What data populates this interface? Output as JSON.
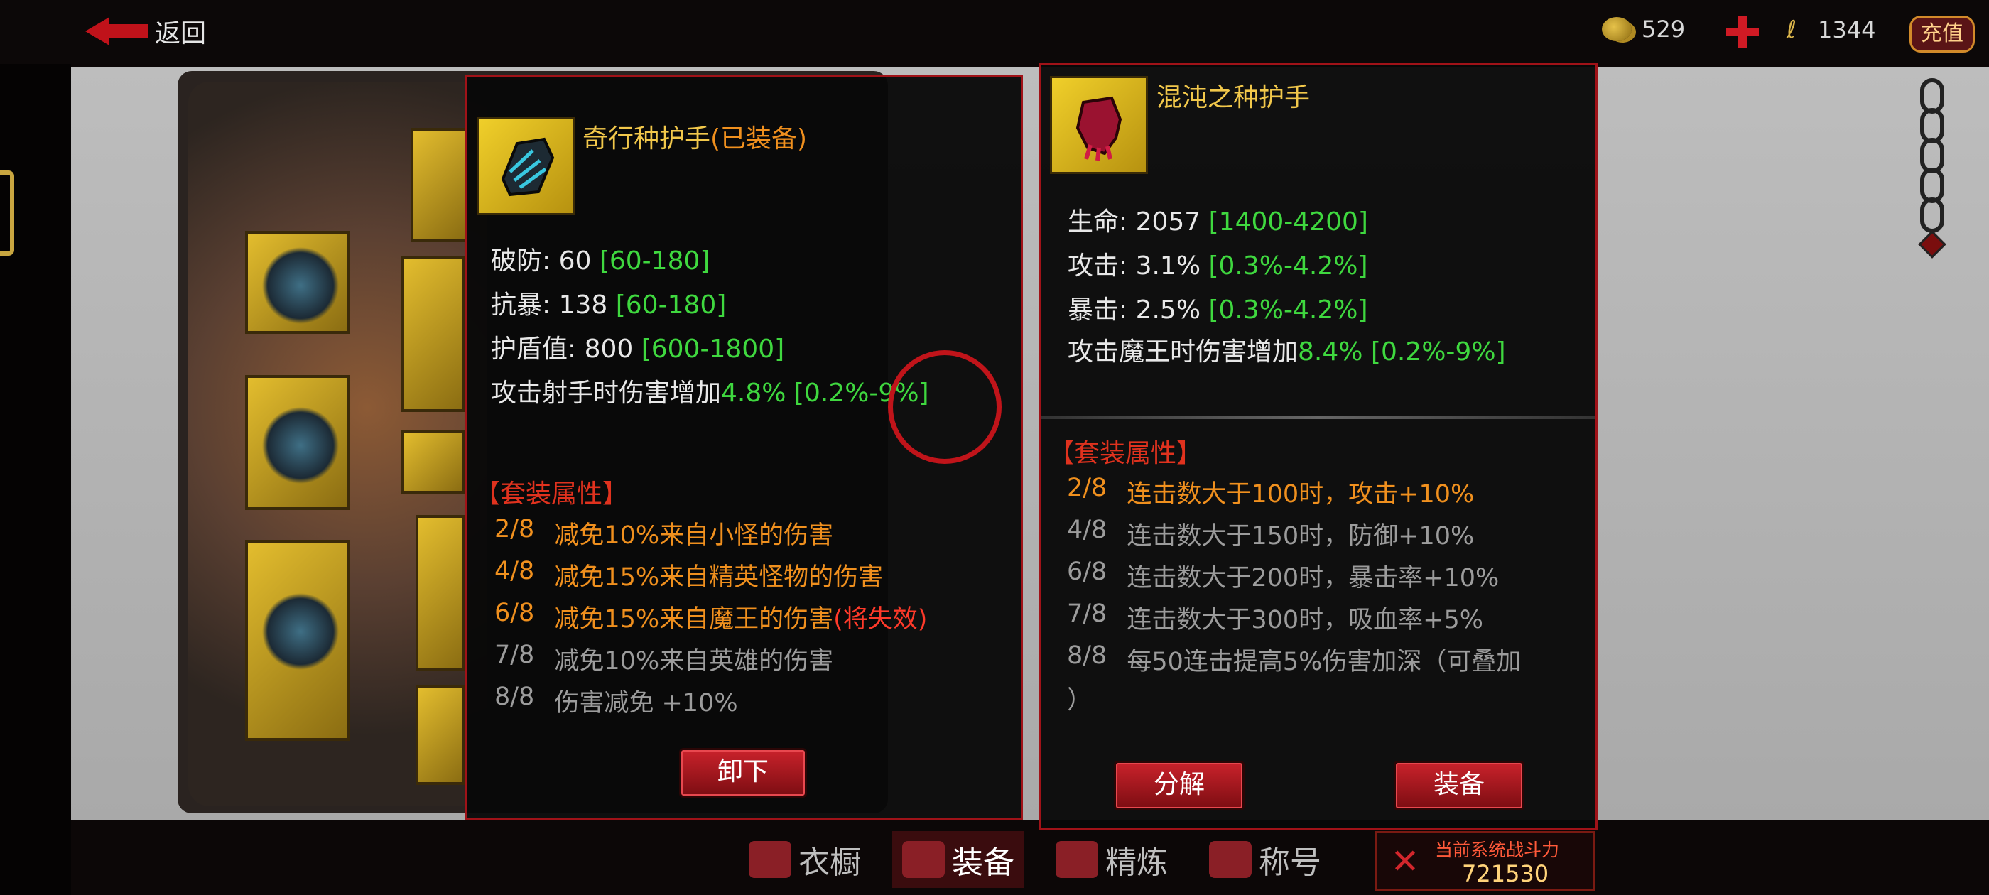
{
  "topbar": {
    "back_label": "返回",
    "coins": "529",
    "gems": "1344",
    "charge_label": "充值"
  },
  "left_panel": {
    "item_name": "奇行种护手",
    "item_status": "(已装备)",
    "stats": [
      {
        "label": "破防: 60 ",
        "range": "[60-180]"
      },
      {
        "label": "抗暴: 138 ",
        "range": "[60-180]"
      },
      {
        "label": "护盾值: 800 ",
        "range": "[600-1800]"
      },
      {
        "label": "攻击射手时伤害增加",
        "value": "4.8%",
        "range": " [0.2%-9%]"
      }
    ],
    "set_title": "【套装属性】",
    "set_rows": [
      {
        "count": "2/8",
        "text": "减免10%来自小怪的伤害",
        "active": true
      },
      {
        "count": "4/8",
        "text": "减免15%来自精英怪物的伤害",
        "active": true
      },
      {
        "count": "6/8",
        "text": "减免15%来自魔王的伤害",
        "warn": "(将失效)",
        "active": true
      },
      {
        "count": "7/8",
        "text": "减免10%来自英雄的伤害",
        "active": false
      },
      {
        "count": "8/8",
        "text": "伤害减免 +10%",
        "active": false
      }
    ],
    "unequip_label": "卸下"
  },
  "right_panel": {
    "item_name": "混沌之种护手",
    "stats": [
      {
        "label": "生命: 2057 ",
        "range": "[1400-4200]"
      },
      {
        "label": "攻击: 3.1% ",
        "range": "[0.3%-4.2%]"
      },
      {
        "label": "暴击: 2.5% ",
        "range": "[0.3%-4.2%]"
      },
      {
        "label": "攻击魔王时伤害增加",
        "value": "8.4%",
        "range": " [0.2%-9%]"
      }
    ],
    "set_title": "【套装属性】",
    "set_rows": [
      {
        "count": "2/8",
        "text": "连击数大于100时，攻击+10%",
        "active": true
      },
      {
        "count": "4/8",
        "text": "连击数大于150时，防御+10%",
        "active": false
      },
      {
        "count": "6/8",
        "text": "连击数大于200时，暴击率+10%",
        "active": false
      },
      {
        "count": "7/8",
        "text": "连击数大于300时，吸血率+5%",
        "active": false
      },
      {
        "count": "8/8",
        "text": "每50连击提高5%伤害加深（可叠加",
        "text2": "）",
        "active": false
      }
    ],
    "decompose_label": "分解",
    "equip_label": "装备"
  },
  "tabs": [
    {
      "label": "衣橱",
      "active": false
    },
    {
      "label": "装备",
      "active": true
    },
    {
      "label": "精炼",
      "active": false
    },
    {
      "label": "称号",
      "active": false
    }
  ],
  "power": {
    "label": "当前系统战斗力",
    "value": "721530"
  },
  "colors": {
    "accent_red": "#c0121a",
    "range_green": "#3fd83f",
    "set_active": "#f0901e",
    "set_inactive": "#9c9c9c",
    "gold_text": "#f2c84b"
  }
}
